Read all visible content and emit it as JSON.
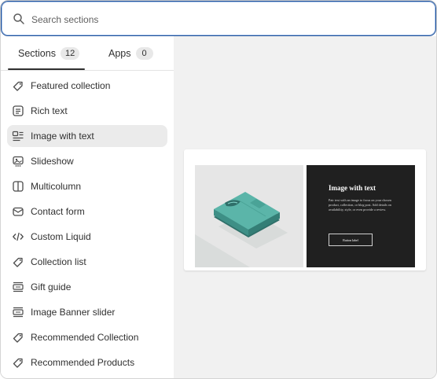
{
  "search": {
    "placeholder": "Search sections",
    "value": ""
  },
  "tabs": [
    {
      "label": "Sections",
      "count": "12",
      "active": true
    },
    {
      "label": "Apps",
      "count": "0",
      "active": false
    }
  ],
  "sections": [
    {
      "label": "Featured collection",
      "icon": "tag-icon"
    },
    {
      "label": "Rich text",
      "icon": "text-block-icon"
    },
    {
      "label": "Image with text",
      "icon": "image-with-text-icon",
      "selected": true
    },
    {
      "label": "Slideshow",
      "icon": "slideshow-icon"
    },
    {
      "label": "Multicolumn",
      "icon": "columns-icon"
    },
    {
      "label": "Contact form",
      "icon": "envelope-icon"
    },
    {
      "label": "Custom Liquid",
      "icon": "code-icon"
    },
    {
      "label": "Collection list",
      "icon": "tag-icon"
    },
    {
      "label": "Gift guide",
      "icon": "list-icon"
    },
    {
      "label": "Image Banner slider",
      "icon": "list-icon"
    },
    {
      "label": "Recommended Collection",
      "icon": "tag-icon"
    },
    {
      "label": "Recommended Products",
      "icon": "tag-icon"
    }
  ],
  "preview": {
    "title": "Image with text",
    "body": "Pair text with an image to focus on your chosen product, collection, or blog post. Add details on availability, style, or even provide a review.",
    "button_label": "Button label"
  },
  "colors": {
    "focus_border": "#1f5199",
    "selected_item_bg": "#ebebeb",
    "preview_background": "#f1f1f1",
    "shirt_teal": "#5bb5a9",
    "text_panel_bg": "#202020"
  }
}
